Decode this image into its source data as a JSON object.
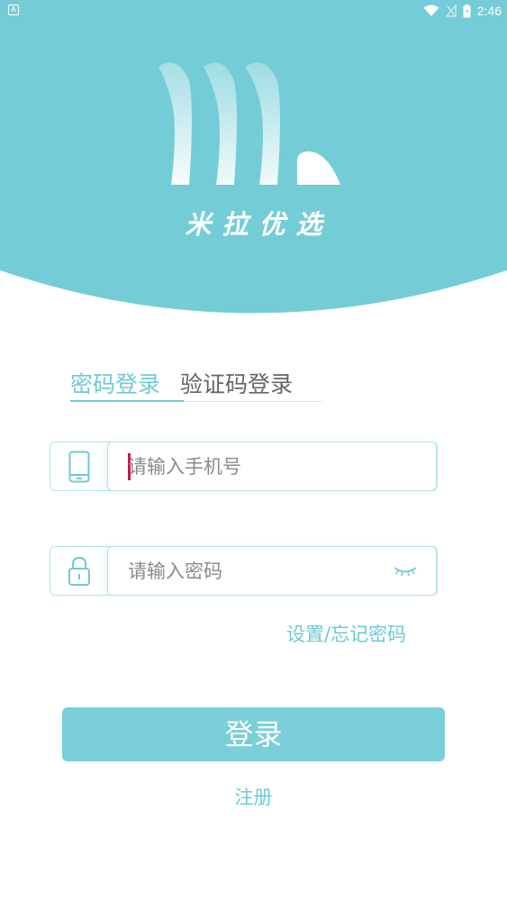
{
  "status_bar": {
    "app_icon_letter": "A",
    "time": "2:46",
    "icons": [
      "wifi-icon",
      "signal-icon",
      "battery-icon"
    ]
  },
  "brand": {
    "name": "米拉优选",
    "logo_icon": "brand-logo-icon"
  },
  "tabs": [
    {
      "label": "密码登录",
      "active": true
    },
    {
      "label": "验证码登录",
      "active": false
    }
  ],
  "phone_field": {
    "icon": "phone-icon",
    "placeholder": "请输入手机号",
    "value": ""
  },
  "password_field": {
    "icon": "lock-icon",
    "placeholder": "请输入密码",
    "value": "",
    "toggle_icon": "eye-closed-icon"
  },
  "links": {
    "forgot_password": "设置/忘记密码",
    "register": "注册"
  },
  "login_button_label": "登录",
  "colors": {
    "primary": "#6fcad3",
    "header_bg": "#74cdd6",
    "button": "#7acfd8",
    "text_inactive": "#666666",
    "placeholder": "#8a8a8a",
    "caret": "#c2185b"
  }
}
